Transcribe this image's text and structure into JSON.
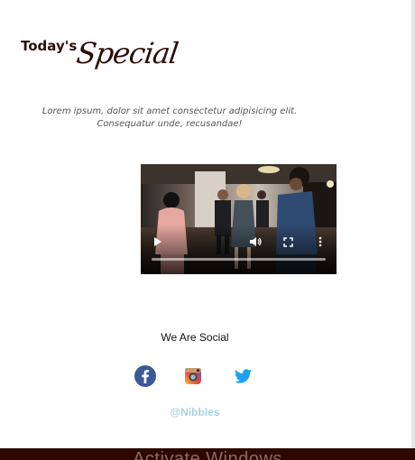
{
  "heading": {
    "todays": "Today's",
    "special": "Special"
  },
  "intro": {
    "line1": "Lorem ipsum, dolor sit amet consectetur adipisicing elit.",
    "line2": "Consequatur unde, recusandae!"
  },
  "video": {
    "controls": {
      "play_icon": "play-icon",
      "volume_icon": "volume-icon",
      "fullscreen_icon": "fullscreen-icon",
      "more_icon": "more-options-icon"
    },
    "progress": 0
  },
  "social": {
    "title": "We Are Social",
    "icons": [
      "facebook-icon",
      "instagram-icon",
      "twitter-icon"
    ],
    "handle": "@Nibbles"
  },
  "footer": {
    "text": "Activate Windows"
  },
  "colors": {
    "heading": "#2b0d06",
    "footer_bg": "#2e0702",
    "handle": "#a9d3e0",
    "facebook": "#3b5998",
    "twitter": "#1da1f2"
  }
}
